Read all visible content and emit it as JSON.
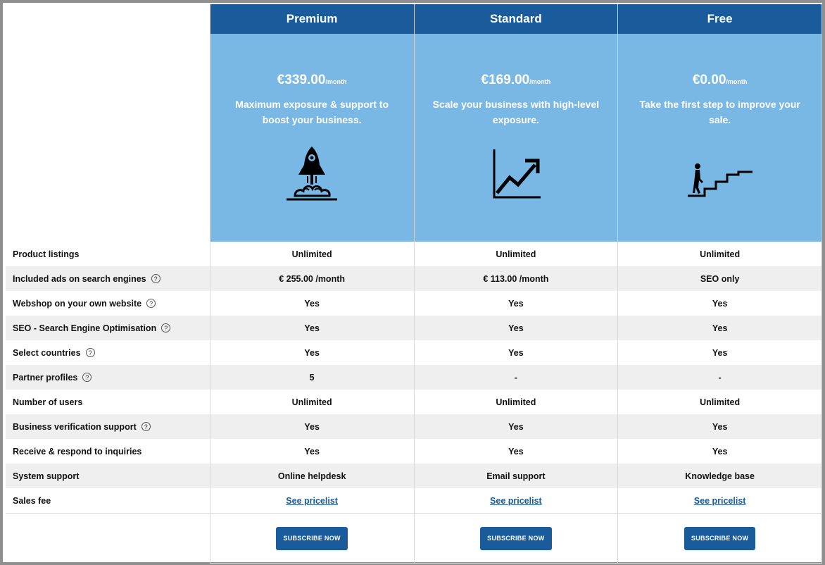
{
  "plans": [
    {
      "name": "Premium",
      "price": "€339.00",
      "per": "/month",
      "description": "Maximum exposure & support to boost your business.",
      "icon": "rocket-icon"
    },
    {
      "name": "Standard",
      "price": "€169.00",
      "per": "/month",
      "description": "Scale your business with high-level exposure.",
      "icon": "growth-chart-icon"
    },
    {
      "name": "Free",
      "price": "€0.00",
      "per": "/month",
      "description": "Take the first step to improve your sale.",
      "icon": "stairs-climber-icon"
    }
  ],
  "features": [
    {
      "label": "Product listings",
      "help": false,
      "values": [
        "Unlimited",
        "Unlimited",
        "Unlimited"
      ]
    },
    {
      "label": "Included ads on search engines",
      "help": true,
      "values": [
        "€ 255.00 /month",
        "€ 113.00 /month",
        "SEO only"
      ]
    },
    {
      "label": "Webshop on your own website",
      "help": true,
      "values": [
        "Yes",
        "Yes",
        "Yes"
      ]
    },
    {
      "label": "SEO - Search Engine Optimisation",
      "help": true,
      "values": [
        "Yes",
        "Yes",
        "Yes"
      ]
    },
    {
      "label": "Select countries",
      "help": true,
      "values": [
        "Yes",
        "Yes",
        "Yes"
      ]
    },
    {
      "label": "Partner profiles",
      "help": true,
      "values": [
        "5",
        "-",
        "-"
      ]
    },
    {
      "label": "Number of users",
      "help": false,
      "values": [
        "Unlimited",
        "Unlimited",
        "Unlimited"
      ]
    },
    {
      "label": "Business verification support",
      "help": true,
      "values": [
        "Yes",
        "Yes",
        "Yes"
      ]
    },
    {
      "label": "Receive & respond to inquiries",
      "help": false,
      "values": [
        "Yes",
        "Yes",
        "Yes"
      ]
    },
    {
      "label": "System support",
      "help": false,
      "values": [
        "Online helpdesk",
        "Email support",
        "Knowledge base"
      ]
    },
    {
      "label": "Sales fee",
      "help": false,
      "values": [
        "See pricelist",
        "See pricelist",
        "See pricelist"
      ],
      "links": true
    }
  ],
  "help_glyph": "?",
  "subscribe_label": "SUBSCRIBE NOW",
  "colors": {
    "header_dark": "#1a5b9b",
    "header_light": "#79b7e5",
    "row_alt": "#efefef"
  }
}
